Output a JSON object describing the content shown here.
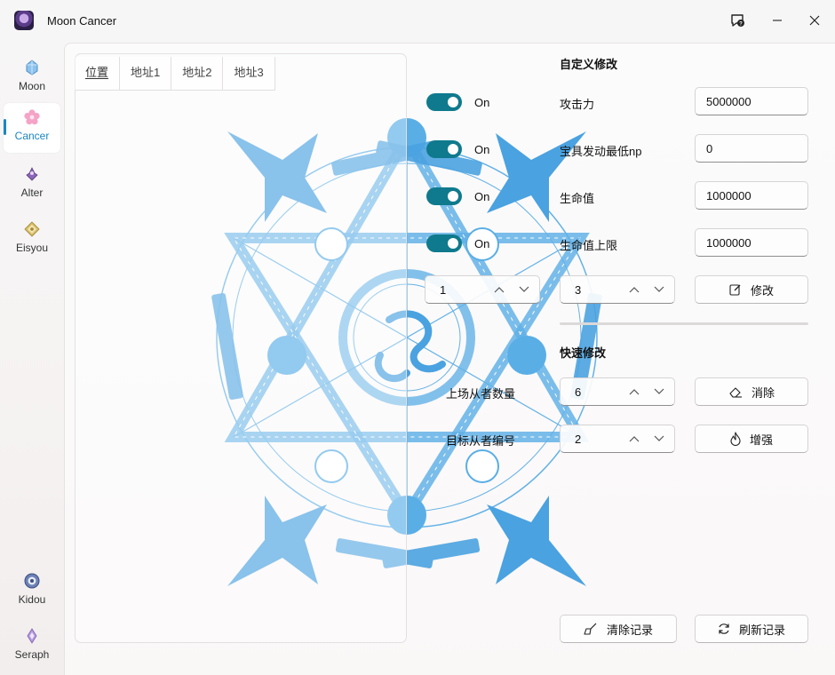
{
  "app": {
    "title": "Moon Cancer"
  },
  "sidebar": {
    "items": [
      {
        "label": "Moon",
        "icon": "crystal-icon",
        "color": "#6aa9e0"
      },
      {
        "label": "Cancer",
        "icon": "sakura-icon",
        "color": "#f08ab8"
      },
      {
        "label": "Alter",
        "icon": "alter-icon",
        "color": "#7c5aa6"
      },
      {
        "label": "Eisyou",
        "icon": "eisyou-icon",
        "color": "#c7a64b"
      }
    ],
    "footer_items": [
      {
        "label": "Kidou",
        "icon": "kidou-icon",
        "color": "#5a6fa8"
      },
      {
        "label": "Seraph",
        "icon": "seraph-icon",
        "color": "#9a7cc8"
      }
    ]
  },
  "tabs": [
    "位置",
    "地址1",
    "地址2",
    "地址3"
  ],
  "toggles": [
    {
      "label": "On",
      "on": true
    },
    {
      "label": "On",
      "on": true
    },
    {
      "label": "On",
      "on": true
    },
    {
      "label": "On",
      "on": true
    }
  ],
  "custom": {
    "title": "自定义修改",
    "fields": [
      {
        "label": "攻击力",
        "value": "5000000"
      },
      {
        "label": "宝具发动最低np",
        "value": "0"
      },
      {
        "label": "生命值",
        "value": "1000000"
      },
      {
        "label": "生命值上限",
        "value": "1000000"
      }
    ],
    "spinner_a": "1",
    "spinner_b": "3",
    "modify_button": "修改"
  },
  "quick": {
    "title": "快速修改",
    "count_label": "上场从者数量",
    "count_value": "6",
    "target_label": "目标从者编号",
    "target_value": "2",
    "clear_button": "消除",
    "boost_button": "增强"
  },
  "footer": {
    "clear_log_button": "清除记录",
    "refresh_log_button": "刷新记录"
  },
  "colors": {
    "accent": "#1a86c2",
    "toggle": "#0f7a8d",
    "magic_circle": "#5aaee6"
  }
}
